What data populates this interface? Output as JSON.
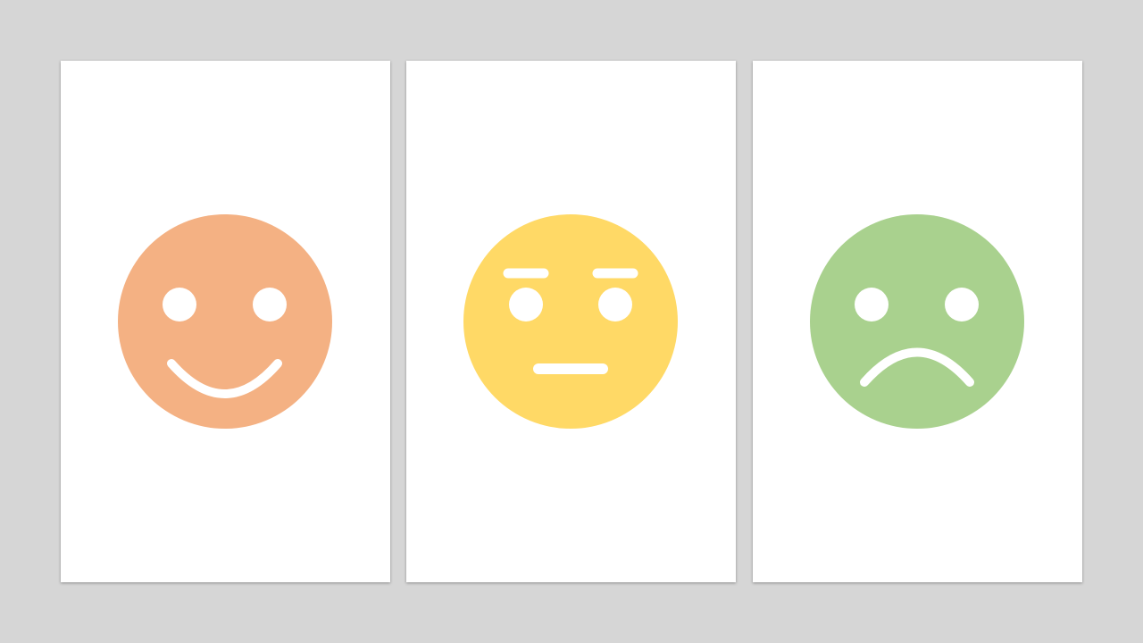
{
  "cards": [
    {
      "mood": "happy",
      "icon": "happy-face-icon",
      "color": "#F4B183"
    },
    {
      "mood": "neutral",
      "icon": "neutral-face-icon",
      "color": "#FFD966"
    },
    {
      "mood": "sad",
      "icon": "sad-face-icon",
      "color": "#A9D18E"
    }
  ],
  "feature_color": "#FFFFFF",
  "background_color": "#D6D6D6"
}
